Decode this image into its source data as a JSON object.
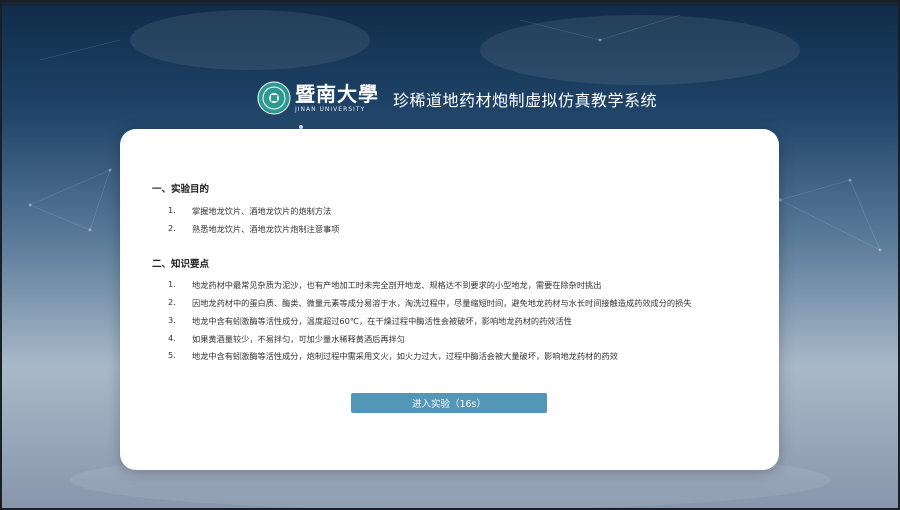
{
  "header": {
    "university_cn": "暨南大學",
    "university_en": "JINAN UNIVERSITY",
    "system_title": "珍稀道地药材炮制虚拟仿真教学系统"
  },
  "sections": [
    {
      "title": "一、实验目的",
      "items": [
        {
          "num": "1.",
          "text": "掌握地龙饮片、酒地龙饮片的炮制方法"
        },
        {
          "num": "2.",
          "text": "熟悉地龙饮片、酒地龙饮片炮制注意事项"
        }
      ]
    },
    {
      "title": "二、知识要点",
      "items": [
        {
          "num": "1.",
          "text": "地龙药材中最常见杂质为泥沙，也有产地加工时未完全剖开地龙、规格达不到要求的小型地龙，需要在除杂时挑出"
        },
        {
          "num": "2.",
          "text": "因地龙药材中的蛋白质、酶类、微量元素等成分易溶于水，淘洗过程中，尽量缩短时间，避免地龙药材与水长时间接触造成药效成分的损失"
        },
        {
          "num": "3.",
          "text": "地龙中含有蚓激酶等活性成分，温度超过60℃，在干燥过程中酶活性会被破坏，影响地龙药材的药效活性"
        },
        {
          "num": "4.",
          "text": "如果黄酒量较少，不易拌匀，可加少量水稀释黄酒后再拌匀"
        },
        {
          "num": "5.",
          "text": "地龙中含有蚓激酶等活性成分，炮制过程中需采用文火，如火力过大，过程中酶活会被大量破坏，影响地龙药材的药效"
        }
      ]
    }
  ],
  "enter_button": {
    "label": "进入实验（16s）"
  },
  "colors": {
    "button": "#5496b6",
    "emblem": "#2c9a8e"
  }
}
